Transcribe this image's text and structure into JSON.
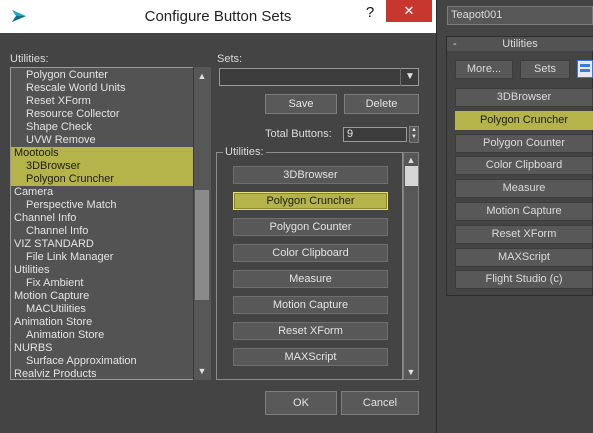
{
  "dialog": {
    "title": "Configure Button Sets",
    "help_glyph": "?",
    "close_glyph": "✕",
    "utilities_label": "Utilities:",
    "sets_label": "Sets:",
    "save_label": "Save",
    "delete_label": "Delete",
    "total_buttons_label": "Total Buttons:",
    "total_buttons_value": "9",
    "group_label": "Utilities:",
    "ok_label": "OK",
    "cancel_label": "Cancel",
    "list_items": [
      {
        "label": "Polygon Counter",
        "level": 1
      },
      {
        "label": "Rescale World Units",
        "level": 1
      },
      {
        "label": "Reset XForm",
        "level": 1
      },
      {
        "label": "Resource Collector",
        "level": 1
      },
      {
        "label": "Shape Check",
        "level": 1
      },
      {
        "label": "UVW Remove",
        "level": 1
      },
      {
        "label": "Mootools",
        "level": 0,
        "highlighted": true
      },
      {
        "label": "3DBrowser",
        "level": 1,
        "highlighted": true
      },
      {
        "label": "Polygon Cruncher",
        "level": 1,
        "highlighted": true
      },
      {
        "label": "Camera",
        "level": 0
      },
      {
        "label": "Perspective Match",
        "level": 1
      },
      {
        "label": "Channel Info",
        "level": 0
      },
      {
        "label": "Channel Info",
        "level": 1
      },
      {
        "label": "VIZ STANDARD",
        "level": 0
      },
      {
        "label": "File Link Manager",
        "level": 1
      },
      {
        "label": "Utilities",
        "level": 0
      },
      {
        "label": "Fix Ambient",
        "level": 1
      },
      {
        "label": "Motion Capture",
        "level": 0
      },
      {
        "label": "MACUtilities",
        "level": 1
      },
      {
        "label": "Animation Store",
        "level": 0
      },
      {
        "label": "Animation Store",
        "level": 1
      },
      {
        "label": "NURBS",
        "level": 0
      },
      {
        "label": "Surface Approximation",
        "level": 1
      },
      {
        "label": "Realviz Products",
        "level": 0
      }
    ],
    "group_buttons": [
      {
        "label": "3DBrowser"
      },
      {
        "label": "Polygon Cruncher",
        "selected": true
      },
      {
        "label": "Polygon Counter"
      },
      {
        "label": "Color Clipboard"
      },
      {
        "label": "Measure"
      },
      {
        "label": "Motion Capture"
      },
      {
        "label": "Reset XForm"
      },
      {
        "label": "MAXScript"
      }
    ]
  },
  "panel": {
    "object_name": "Teapot001",
    "rollout_toggle": "-",
    "rollout_title": "Utilities",
    "more_label": "More...",
    "sets_label": "Sets",
    "buttons": [
      {
        "label": "3DBrowser"
      },
      {
        "label": "Polygon Cruncher",
        "highlighted": true
      },
      {
        "label": "Polygon Counter"
      },
      {
        "label": "Color Clipboard"
      },
      {
        "label": "Measure"
      },
      {
        "label": "Motion Capture"
      },
      {
        "label": "Reset XForm"
      },
      {
        "label": "MAXScript"
      },
      {
        "label": "Flight Studio (c)"
      }
    ]
  },
  "colors": {
    "highlight": "#b5b44b",
    "background": "#444444",
    "close_button": "#c7372f",
    "app_icon": "#1ba6c9"
  },
  "icons": [
    "app-icon",
    "help-icon",
    "close-icon",
    "chevron-down-icon",
    "scroll-up-icon",
    "scroll-down-icon",
    "spinner-icon",
    "configure-sets-icon"
  ]
}
